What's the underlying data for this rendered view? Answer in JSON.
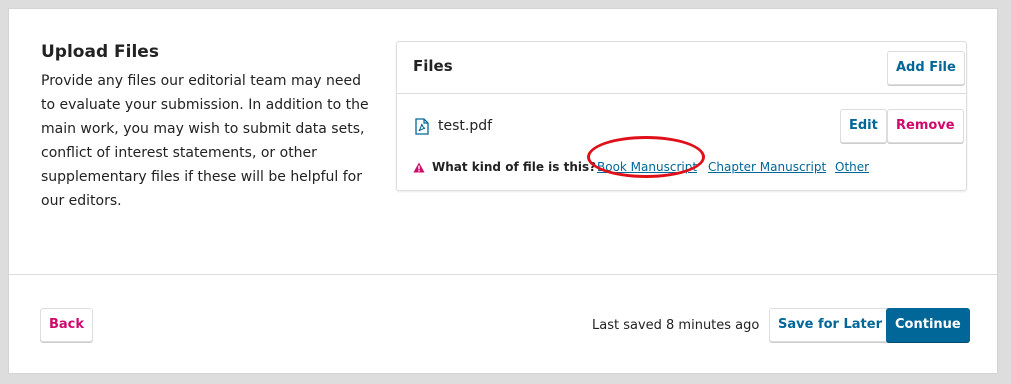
{
  "upload": {
    "title": "Upload Files",
    "description": "Provide any files our editorial team may need to evaluate your submission. In addition to the main work, you may wish to submit data sets, conflict of interest statements, or other supplementary files if these will be helpful for our editors."
  },
  "files_panel": {
    "heading": "Files",
    "add_file_label": "Add File",
    "file": {
      "name": "test.pdf",
      "icon": "pdf-file-icon",
      "edit_label": "Edit",
      "remove_label": "Remove"
    },
    "file_kind": {
      "question": "What kind of file is this?",
      "icon": "warning-icon",
      "options": [
        "Book Manuscript",
        "Chapter Manuscript",
        "Other"
      ]
    }
  },
  "footer": {
    "back_label": "Back",
    "last_saved": "Last saved 8 minutes ago",
    "save_later_label": "Save for Later",
    "continue_label": "Continue"
  },
  "colors": {
    "accent": "#006798",
    "danger": "#d00a6c",
    "warning": "#d00a6c",
    "highlight_ring": "#e0101a"
  }
}
